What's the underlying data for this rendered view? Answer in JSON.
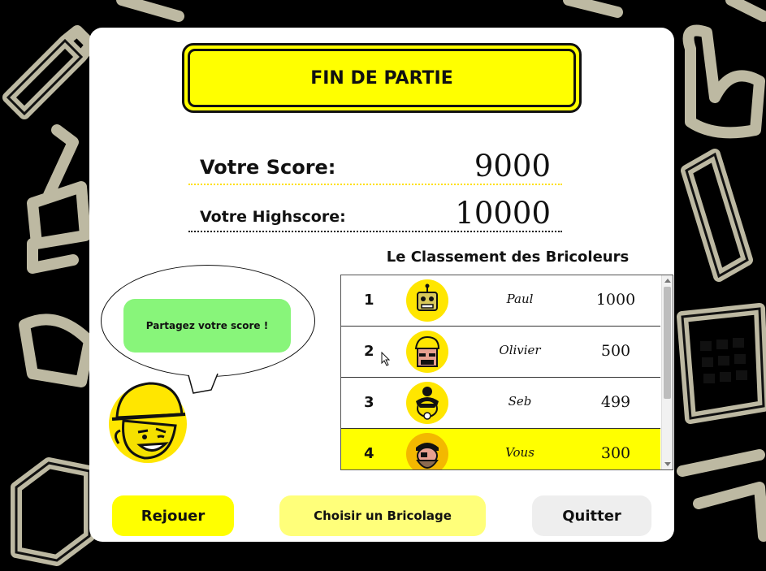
{
  "title": "FIN DE PARTIE",
  "score": {
    "label": "Votre Score:",
    "value": "9000"
  },
  "highscore": {
    "label": "Votre Highscore:",
    "value": "10000"
  },
  "share_label": "Partagez votre score !",
  "leaderboard": {
    "title": "Le Classement des Bricoleurs",
    "rows": [
      {
        "rank": "1",
        "name": "Paul",
        "score": "1000",
        "avatar": "robot-avatar"
      },
      {
        "rank": "2",
        "name": "Olivier",
        "score": "500",
        "avatar": "builder-avatar"
      },
      {
        "rank": "3",
        "name": "Seb",
        "score": "499",
        "avatar": "bun-hair-avatar"
      },
      {
        "rank": "4",
        "name": "Vous",
        "score": "300",
        "avatar": "pirate-avatar"
      }
    ]
  },
  "buttons": {
    "replay": "Rejouer",
    "choose": "Choisir un Bricolage",
    "quit": "Quitter"
  },
  "colors": {
    "accent_yellow": "#ffff00",
    "share_green": "#88f57a",
    "background": "#000000",
    "pattern": "#bdb9a2"
  }
}
